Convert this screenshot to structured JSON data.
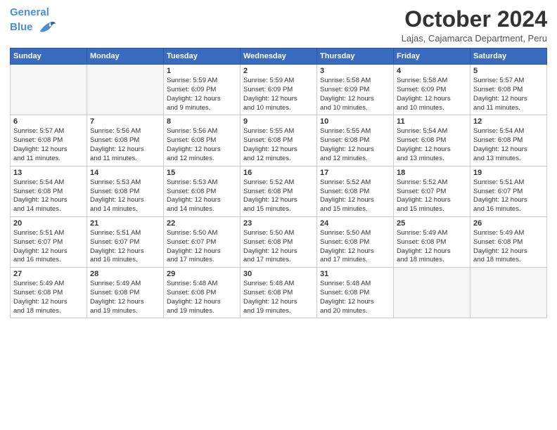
{
  "header": {
    "logo_line1": "General",
    "logo_line2": "Blue",
    "month": "October 2024",
    "location": "Lajas, Cajamarca Department, Peru"
  },
  "weekdays": [
    "Sunday",
    "Monday",
    "Tuesday",
    "Wednesday",
    "Thursday",
    "Friday",
    "Saturday"
  ],
  "weeks": [
    [
      {
        "day": "",
        "info": "",
        "empty": true
      },
      {
        "day": "",
        "info": "",
        "empty": true
      },
      {
        "day": "1",
        "info": "Sunrise: 5:59 AM\nSunset: 6:09 PM\nDaylight: 12 hours\nand 9 minutes."
      },
      {
        "day": "2",
        "info": "Sunrise: 5:59 AM\nSunset: 6:09 PM\nDaylight: 12 hours\nand 10 minutes."
      },
      {
        "day": "3",
        "info": "Sunrise: 5:58 AM\nSunset: 6:09 PM\nDaylight: 12 hours\nand 10 minutes."
      },
      {
        "day": "4",
        "info": "Sunrise: 5:58 AM\nSunset: 6:09 PM\nDaylight: 12 hours\nand 10 minutes."
      },
      {
        "day": "5",
        "info": "Sunrise: 5:57 AM\nSunset: 6:08 PM\nDaylight: 12 hours\nand 11 minutes."
      }
    ],
    [
      {
        "day": "6",
        "info": "Sunrise: 5:57 AM\nSunset: 6:08 PM\nDaylight: 12 hours\nand 11 minutes."
      },
      {
        "day": "7",
        "info": "Sunrise: 5:56 AM\nSunset: 6:08 PM\nDaylight: 12 hours\nand 11 minutes."
      },
      {
        "day": "8",
        "info": "Sunrise: 5:56 AM\nSunset: 6:08 PM\nDaylight: 12 hours\nand 12 minutes."
      },
      {
        "day": "9",
        "info": "Sunrise: 5:55 AM\nSunset: 6:08 PM\nDaylight: 12 hours\nand 12 minutes."
      },
      {
        "day": "10",
        "info": "Sunrise: 5:55 AM\nSunset: 6:08 PM\nDaylight: 12 hours\nand 12 minutes."
      },
      {
        "day": "11",
        "info": "Sunrise: 5:54 AM\nSunset: 6:08 PM\nDaylight: 12 hours\nand 13 minutes."
      },
      {
        "day": "12",
        "info": "Sunrise: 5:54 AM\nSunset: 6:08 PM\nDaylight: 12 hours\nand 13 minutes."
      }
    ],
    [
      {
        "day": "13",
        "info": "Sunrise: 5:54 AM\nSunset: 6:08 PM\nDaylight: 12 hours\nand 14 minutes."
      },
      {
        "day": "14",
        "info": "Sunrise: 5:53 AM\nSunset: 6:08 PM\nDaylight: 12 hours\nand 14 minutes."
      },
      {
        "day": "15",
        "info": "Sunrise: 5:53 AM\nSunset: 6:08 PM\nDaylight: 12 hours\nand 14 minutes."
      },
      {
        "day": "16",
        "info": "Sunrise: 5:52 AM\nSunset: 6:08 PM\nDaylight: 12 hours\nand 15 minutes."
      },
      {
        "day": "17",
        "info": "Sunrise: 5:52 AM\nSunset: 6:08 PM\nDaylight: 12 hours\nand 15 minutes."
      },
      {
        "day": "18",
        "info": "Sunrise: 5:52 AM\nSunset: 6:07 PM\nDaylight: 12 hours\nand 15 minutes."
      },
      {
        "day": "19",
        "info": "Sunrise: 5:51 AM\nSunset: 6:07 PM\nDaylight: 12 hours\nand 16 minutes."
      }
    ],
    [
      {
        "day": "20",
        "info": "Sunrise: 5:51 AM\nSunset: 6:07 PM\nDaylight: 12 hours\nand 16 minutes."
      },
      {
        "day": "21",
        "info": "Sunrise: 5:51 AM\nSunset: 6:07 PM\nDaylight: 12 hours\nand 16 minutes."
      },
      {
        "day": "22",
        "info": "Sunrise: 5:50 AM\nSunset: 6:07 PM\nDaylight: 12 hours\nand 17 minutes."
      },
      {
        "day": "23",
        "info": "Sunrise: 5:50 AM\nSunset: 6:08 PM\nDaylight: 12 hours\nand 17 minutes."
      },
      {
        "day": "24",
        "info": "Sunrise: 5:50 AM\nSunset: 6:08 PM\nDaylight: 12 hours\nand 17 minutes."
      },
      {
        "day": "25",
        "info": "Sunrise: 5:49 AM\nSunset: 6:08 PM\nDaylight: 12 hours\nand 18 minutes."
      },
      {
        "day": "26",
        "info": "Sunrise: 5:49 AM\nSunset: 6:08 PM\nDaylight: 12 hours\nand 18 minutes."
      }
    ],
    [
      {
        "day": "27",
        "info": "Sunrise: 5:49 AM\nSunset: 6:08 PM\nDaylight: 12 hours\nand 18 minutes."
      },
      {
        "day": "28",
        "info": "Sunrise: 5:49 AM\nSunset: 6:08 PM\nDaylight: 12 hours\nand 19 minutes."
      },
      {
        "day": "29",
        "info": "Sunrise: 5:48 AM\nSunset: 6:08 PM\nDaylight: 12 hours\nand 19 minutes."
      },
      {
        "day": "30",
        "info": "Sunrise: 5:48 AM\nSunset: 6:08 PM\nDaylight: 12 hours\nand 19 minutes."
      },
      {
        "day": "31",
        "info": "Sunrise: 5:48 AM\nSunset: 6:08 PM\nDaylight: 12 hours\nand 20 minutes."
      },
      {
        "day": "",
        "info": "",
        "empty": true
      },
      {
        "day": "",
        "info": "",
        "empty": true
      }
    ]
  ]
}
